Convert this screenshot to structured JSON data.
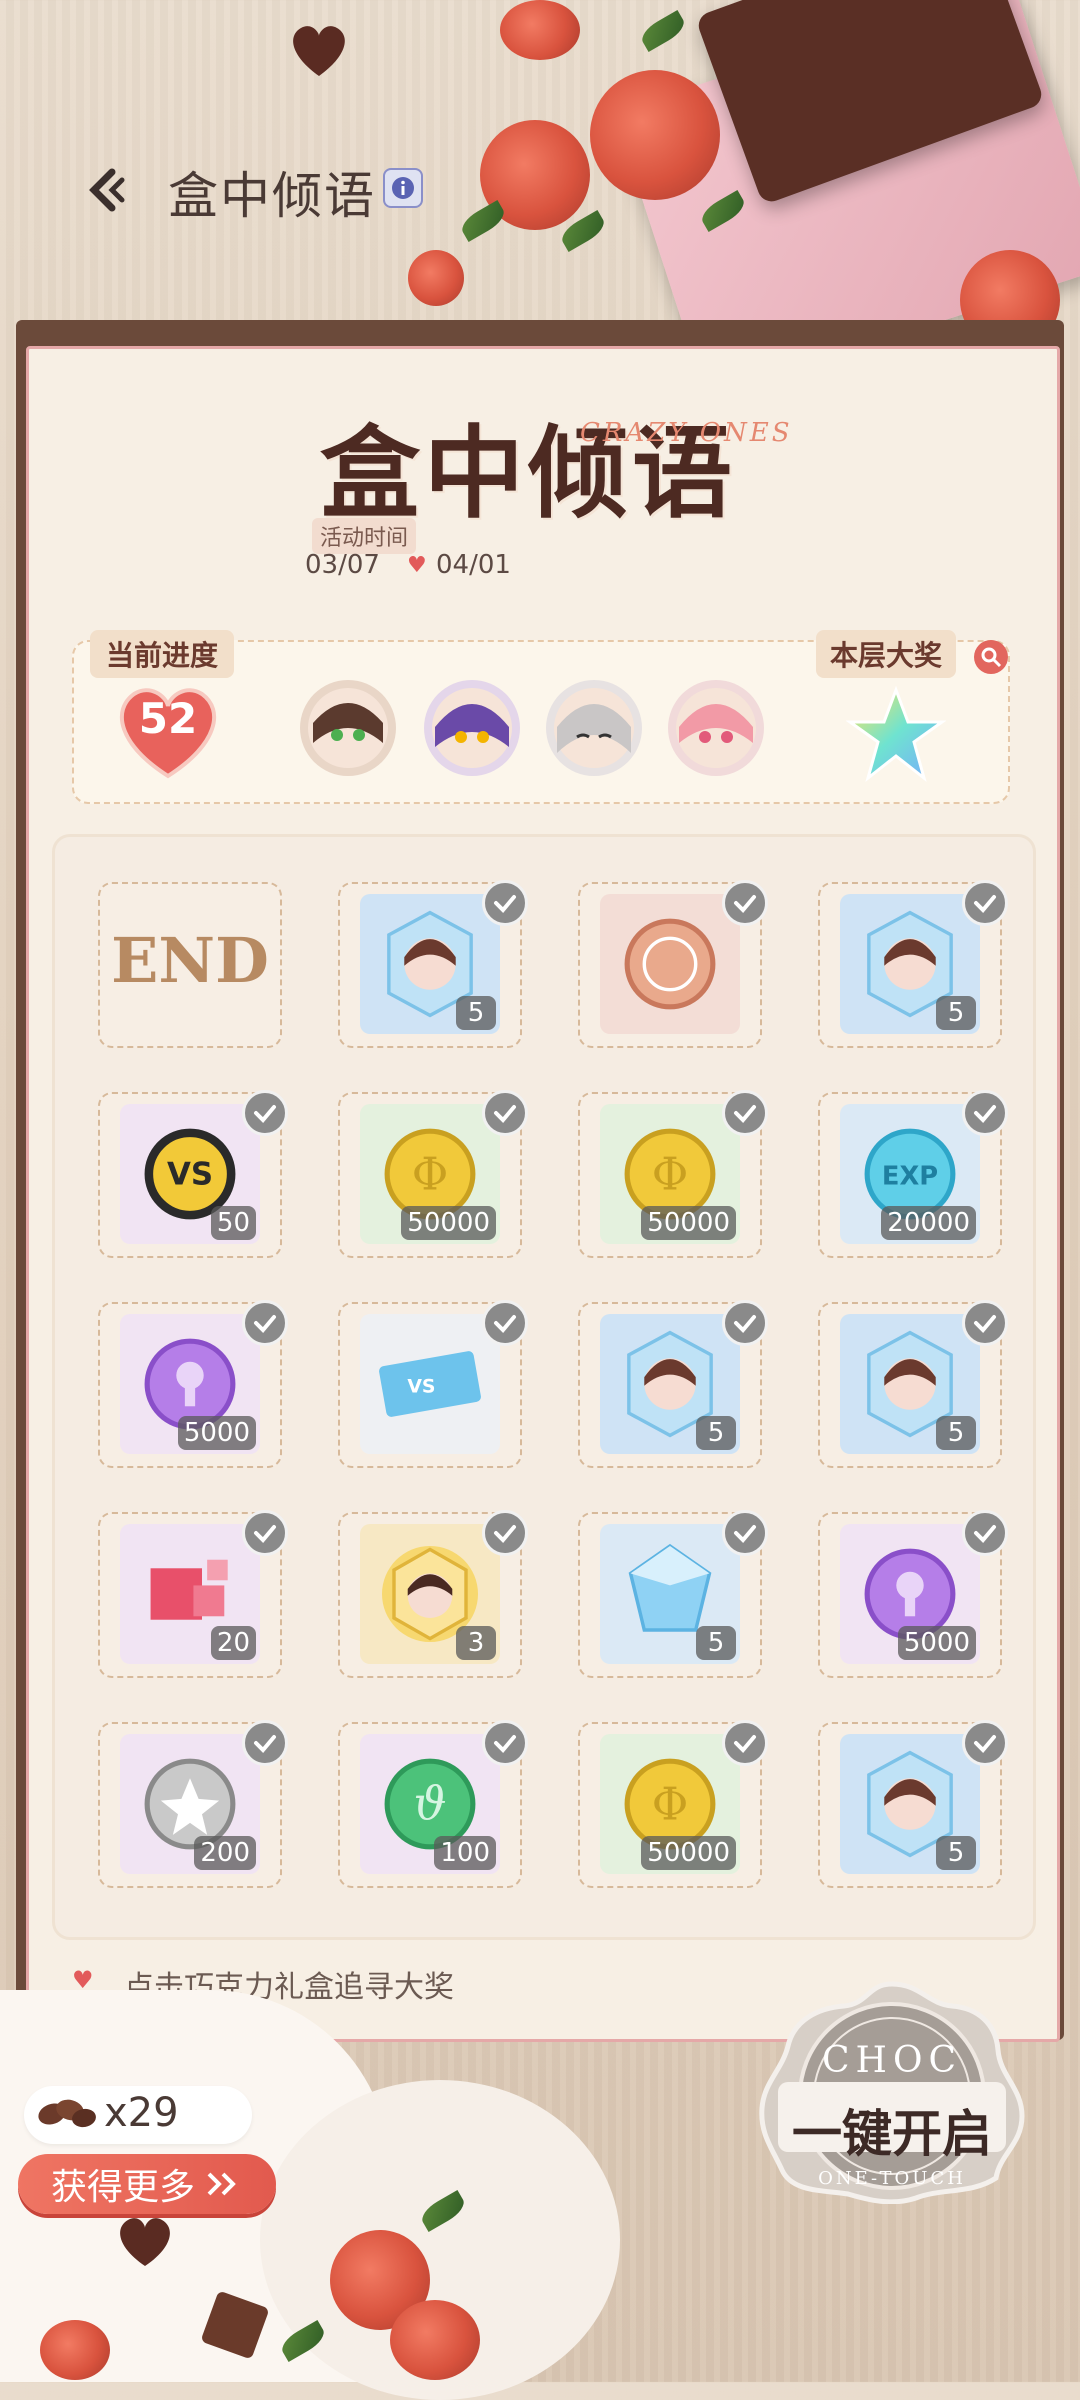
{
  "header": {
    "title": "盒中倾语"
  },
  "banner": {
    "title": "盒中倾语",
    "subtitle": "CRAZY ONES",
    "event_time_label": "活动时间",
    "start_date": "03/07",
    "end_date": "04/01"
  },
  "progress": {
    "label": "当前进度",
    "value": "52",
    "grand_prize_label": "本层大奖"
  },
  "avatars": [
    "character-1",
    "character-2",
    "character-3",
    "character-4"
  ],
  "grid": {
    "end_label": "END",
    "items": [
      {
        "qty": "5",
        "kind": "portrait-shard",
        "color": "#cfe3f5"
      },
      {
        "qty": "",
        "kind": "bronze-medal",
        "color": "#f3ddd6"
      },
      {
        "qty": "5",
        "kind": "portrait-shard",
        "color": "#cfe3f5"
      },
      {
        "qty": "50",
        "kind": "vs-coin",
        "color": "#f1e4f3"
      },
      {
        "qty": "50000",
        "kind": "gold-coin",
        "color": "#e4f1de"
      },
      {
        "qty": "50000",
        "kind": "gold-coin",
        "color": "#e4f1de"
      },
      {
        "qty": "20000",
        "kind": "exp-coin",
        "color": "#dbe9f5"
      },
      {
        "qty": "5000",
        "kind": "purple-coin",
        "color": "#f1e4f3"
      },
      {
        "qty": "",
        "kind": "vs-ticket",
        "color": "#eef0f3"
      },
      {
        "qty": "5",
        "kind": "portrait-shard",
        "color": "#cfe3f5"
      },
      {
        "qty": "5",
        "kind": "portrait-shard",
        "color": "#cfe3f5"
      },
      {
        "qty": "20",
        "kind": "red-cubes",
        "color": "#f1e4f3"
      },
      {
        "qty": "3",
        "kind": "gold-portrait",
        "color": "#f7e8c4"
      },
      {
        "qty": "5",
        "kind": "blue-crystal",
        "color": "#dbe9f5"
      },
      {
        "qty": "5000",
        "kind": "purple-coin",
        "color": "#f1e4f3"
      },
      {
        "qty": "200",
        "kind": "silver-coin",
        "color": "#f1e4f3"
      },
      {
        "qty": "100",
        "kind": "green-coin",
        "color": "#f1e4f3"
      },
      {
        "qty": "50000",
        "kind": "gold-coin",
        "color": "#e4f1de"
      },
      {
        "qty": "5",
        "kind": "portrait-shard",
        "color": "#cfe3f5"
      }
    ]
  },
  "hint": "点击巧克力礼盒追寻大奖",
  "inventory": {
    "count": "x29"
  },
  "buttons": {
    "get_more": "获得更多",
    "one_touch": "一键开启",
    "one_touch_top": "CHOC",
    "one_touch_bottom": "ONE-TOUCH"
  },
  "colors": {
    "accent": "#e25a4e",
    "panel_border": "#6b4a3a",
    "heart": "#e25a5a"
  }
}
